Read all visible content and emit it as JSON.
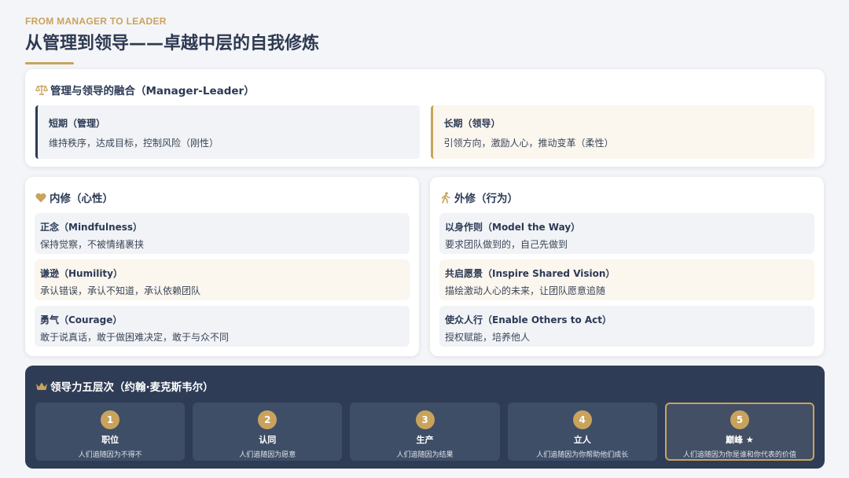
{
  "header": {
    "eyebrow": "FROM MANAGER TO LEADER",
    "title": "从管理到领导——卓越中层的自我修炼"
  },
  "fusion": {
    "title": "管理与领导的融合（Manager-Leader）",
    "icon": "scale-icon",
    "short": {
      "title": "短期（管理）",
      "desc": "维持秩序，达成目标，控制风险（刚性）"
    },
    "long": {
      "title": "长期（领导）",
      "desc": "引领方向，激励人心，推动变革（柔性）"
    }
  },
  "inner": {
    "title": "内修（心性）",
    "icon": "heart-icon",
    "items": [
      {
        "title": "正念（Mindfulness）",
        "desc": "保持觉察，不被情绪裹挟"
      },
      {
        "title": "谦逊（Humility）",
        "desc": "承认错误，承认不知道，承认依赖团队"
      },
      {
        "title": "勇气（Courage）",
        "desc": "敢于说真话，敢于做困难决定，敢于与众不同"
      }
    ]
  },
  "outer": {
    "title": "外修（行为）",
    "icon": "walking-person-icon",
    "items": [
      {
        "title": "以身作则（Model the Way）",
        "desc": "要求团队做到的，自己先做到"
      },
      {
        "title": "共启愿景（Inspire Shared Vision）",
        "desc": "描绘激动人心的未来，让团队愿意追随"
      },
      {
        "title": "使众人行（Enable Others to Act）",
        "desc": "授权赋能，培养他人"
      }
    ]
  },
  "levels": {
    "title": "领导力五层次（约翰·麦克斯韦尔）",
    "icon": "crown-icon",
    "items": [
      {
        "num": "1",
        "title": "职位",
        "desc": "人们追随因为不得不"
      },
      {
        "num": "2",
        "title": "认同",
        "desc": "人们追随因为愿意"
      },
      {
        "num": "3",
        "title": "生产",
        "desc": "人们追随因为结果"
      },
      {
        "num": "4",
        "title": "立人",
        "desc": "人们追随因为你帮助他们成长"
      },
      {
        "num": "5",
        "title": "巅峰 ★",
        "desc": "人们追随因为你是谁和你代表的价值"
      }
    ]
  },
  "colors": {
    "navy": "#2e3c56",
    "gold": "#c9a35c",
    "background": "#f4f5f8"
  }
}
